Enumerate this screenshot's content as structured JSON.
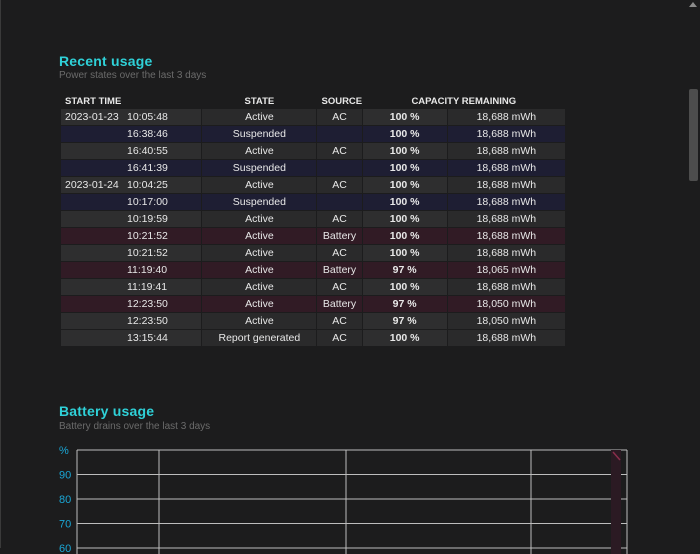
{
  "recent_usage": {
    "title": "Recent usage",
    "subtitle": "Power states over the last 3 days",
    "columns": [
      "START TIME",
      "STATE",
      "SOURCE",
      "CAPACITY REMAINING"
    ],
    "rows": [
      {
        "date": "2023-01-23",
        "time": "10:05:48",
        "state": "Active",
        "source": "AC",
        "pct": "100 %",
        "mwh": "18,688 mWh",
        "kind": "ac"
      },
      {
        "date": "",
        "time": "16:38:46",
        "state": "Suspended",
        "source": "",
        "pct": "100 %",
        "mwh": "18,688 mWh",
        "kind": "susp"
      },
      {
        "date": "",
        "time": "16:40:55",
        "state": "Active",
        "source": "AC",
        "pct": "100 %",
        "mwh": "18,688 mWh",
        "kind": "ac"
      },
      {
        "date": "",
        "time": "16:41:39",
        "state": "Suspended",
        "source": "",
        "pct": "100 %",
        "mwh": "18,688 mWh",
        "kind": "susp"
      },
      {
        "date": "2023-01-24",
        "time": "10:04:25",
        "state": "Active",
        "source": "AC",
        "pct": "100 %",
        "mwh": "18,688 mWh",
        "kind": "ac"
      },
      {
        "date": "",
        "time": "10:17:00",
        "state": "Suspended",
        "source": "",
        "pct": "100 %",
        "mwh": "18,688 mWh",
        "kind": "susp"
      },
      {
        "date": "",
        "time": "10:19:59",
        "state": "Active",
        "source": "AC",
        "pct": "100 %",
        "mwh": "18,688 mWh",
        "kind": "ac"
      },
      {
        "date": "",
        "time": "10:21:52",
        "state": "Active",
        "source": "Battery",
        "pct": "100 %",
        "mwh": "18,688 mWh",
        "kind": "batt"
      },
      {
        "date": "",
        "time": "10:21:52",
        "state": "Active",
        "source": "AC",
        "pct": "100 %",
        "mwh": "18,688 mWh",
        "kind": "ac"
      },
      {
        "date": "",
        "time": "11:19:40",
        "state": "Active",
        "source": "Battery",
        "pct": "97 %",
        "mwh": "18,065 mWh",
        "kind": "batt"
      },
      {
        "date": "",
        "time": "11:19:41",
        "state": "Active",
        "source": "AC",
        "pct": "100 %",
        "mwh": "18,688 mWh",
        "kind": "ac"
      },
      {
        "date": "",
        "time": "12:23:50",
        "state": "Active",
        "source": "Battery",
        "pct": "97 %",
        "mwh": "18,050 mWh",
        "kind": "batt"
      },
      {
        "date": "",
        "time": "12:23:50",
        "state": "Active",
        "source": "AC",
        "pct": "97 %",
        "mwh": "18,050 mWh",
        "kind": "ac"
      },
      {
        "date": "",
        "time": "13:15:44",
        "state": "Report generated",
        "source": "AC",
        "pct": "100 %",
        "mwh": "18,688 mWh",
        "kind": "ac"
      }
    ]
  },
  "battery_usage": {
    "title": "Battery usage",
    "subtitle": "Battery drains over the last 3 days"
  },
  "chart_data": {
    "type": "area",
    "title": "",
    "ylabel": "%",
    "y_ticks": [
      "90",
      "80",
      "70",
      "60"
    ],
    "ylim": [
      60,
      100
    ],
    "grid": true,
    "colors": {
      "axis_label": "#1aa7d6",
      "grid": "#bdbdbd",
      "drain": "#8a2d4b"
    }
  }
}
